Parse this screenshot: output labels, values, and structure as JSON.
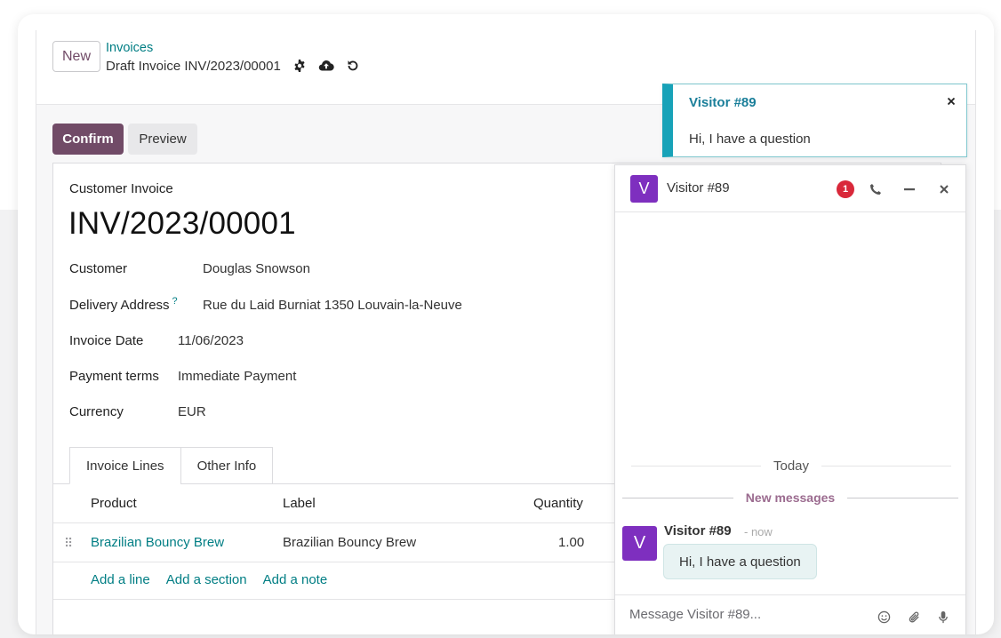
{
  "control_panel": {
    "new_label": "New",
    "breadcrumb_parent": "Invoices",
    "breadcrumb_current": "Draft Invoice INV/2023/00001",
    "icons": [
      "gear-icon",
      "cloud-upload-icon",
      "undo-icon"
    ]
  },
  "actions": {
    "confirm_label": "Confirm",
    "preview_label": "Preview"
  },
  "form": {
    "doc_type": "Customer Invoice",
    "doc_name": "INV/2023/00001",
    "fields": {
      "customer": {
        "label": "Customer",
        "value": "Douglas Snowson"
      },
      "delivery_address": {
        "label": "Delivery Address",
        "help": "?",
        "value": "Rue du Laid Burniat 1350 Louvain-la-Neuve"
      },
      "invoice_date": {
        "label": "Invoice Date",
        "value": "11/06/2023"
      },
      "payment_terms": {
        "label": "Payment terms",
        "value": "Immediate Payment"
      },
      "currency": {
        "label": "Currency",
        "value": "EUR"
      }
    },
    "tabs": [
      {
        "label": "Invoice Lines",
        "active": true
      },
      {
        "label": "Other Info",
        "active": false
      }
    ],
    "table": {
      "columns": [
        "Product",
        "Label",
        "Quantity"
      ],
      "rows": [
        {
          "product": "Brazilian Bouncy Brew",
          "label": "Brazilian Bouncy Brew",
          "quantity": "1.00"
        }
      ],
      "add_line": "Add a line",
      "add_section": "Add a section",
      "add_note": "Add a note"
    }
  },
  "chat": {
    "avatar_letter": "V",
    "title": "Visitor #89",
    "unread_count": "1",
    "today_label": "Today",
    "new_messages_label": "New messages",
    "messages": [
      {
        "author": "Visitor #89",
        "time": "- now",
        "text": "Hi, I have a question"
      }
    ],
    "composer_placeholder": "Message Visitor #89..."
  },
  "notification": {
    "title": "Visitor #89",
    "message": "Hi, I have a question"
  },
  "colors": {
    "primary": "#714b67",
    "link": "#017e84",
    "avatar": "#7e2fbf",
    "badge": "#d9283a",
    "toast_accent": "#17a2b8"
  }
}
